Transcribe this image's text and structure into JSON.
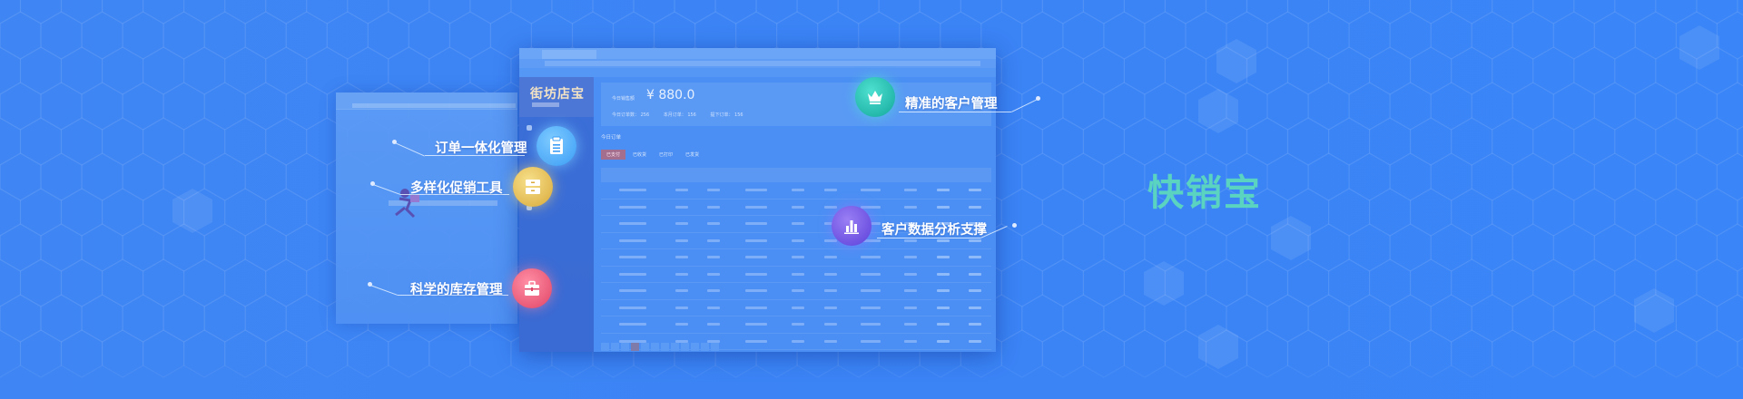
{
  "brand": "快销宝",
  "colors": {
    "background": "#3b84f6",
    "brand_text": "#5ad4c0",
    "label_text": "#ffffff"
  },
  "features": [
    {
      "label": "订单一体化管理",
      "icon": "clipboard-icon",
      "color": "#4aa8f8"
    },
    {
      "label": "多样化促销工具",
      "icon": "cabinet-icon",
      "color": "#e6c258"
    },
    {
      "label": "科学的库存管理",
      "icon": "briefcase-icon",
      "color": "#f0607e"
    },
    {
      "label": "精准的客户管理",
      "icon": "crown-icon",
      "color": "#20c2b4"
    },
    {
      "label": "客户数据分析支撑",
      "icon": "bar-chart-icon",
      "color": "#6a55e6"
    }
  ],
  "app": {
    "logo": "街坊店宝",
    "today_sales_label": "今日销售额",
    "today_sales_amount": "¥ 880.0",
    "stats": [
      "今日订单数： 256",
      "本月订单： 156",
      "提下订单： 156"
    ],
    "orders_title": "今日订单",
    "tabs": [
      "已支付",
      "已收货",
      "已打印",
      "已发货"
    ]
  }
}
